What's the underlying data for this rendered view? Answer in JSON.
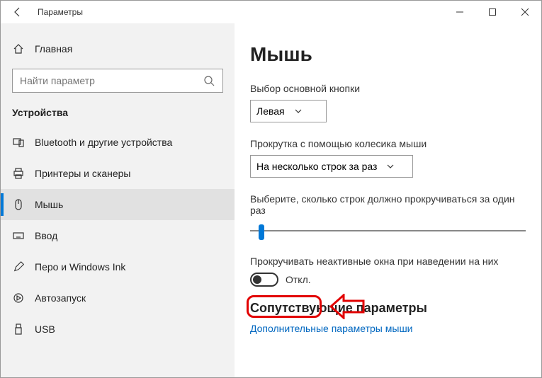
{
  "titlebar": {
    "title": "Параметры"
  },
  "sidebar": {
    "home_label": "Главная",
    "search_placeholder": "Найти параметр",
    "category_title": "Устройства",
    "items": [
      {
        "label": "Bluetooth и другие устройства"
      },
      {
        "label": "Принтеры и сканеры"
      },
      {
        "label": "Мышь"
      },
      {
        "label": "Ввод"
      },
      {
        "label": "Перо и Windows Ink"
      },
      {
        "label": "Автозапуск"
      },
      {
        "label": "USB"
      }
    ],
    "active_index": 2
  },
  "main": {
    "heading": "Мышь",
    "primary_button_label": "Выбор основной кнопки",
    "primary_button_value": "Левая",
    "scroll_wheel_label": "Прокрутка с помощью колесика мыши",
    "scroll_wheel_value": "На несколько строк за раз",
    "lines_label": "Выберите, сколько строк должно прокручиваться за один раз",
    "inactive_scroll_label": "Прокручивать неактивные окна при наведении на них",
    "toggle_state_label": "Откл.",
    "related_heading": "Сопутствующие параметры",
    "related_link": "Дополнительные параметры мыши"
  }
}
